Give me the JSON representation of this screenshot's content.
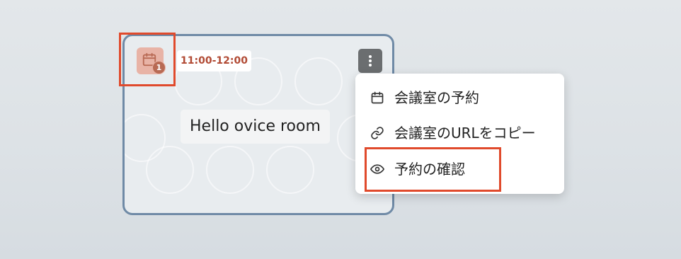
{
  "room": {
    "reservation_count": "1",
    "time_range": "11:00-12:00",
    "name": "Hello ovice room",
    "reservation_icon": "calendar-icon",
    "more_icon": "more-vertical-icon"
  },
  "menu": {
    "items": [
      {
        "label": "会議室の予約",
        "icon": "calendar-icon"
      },
      {
        "label": "会議室のURLをコピー",
        "icon": "link-icon"
      },
      {
        "label": "予約の確認",
        "icon": "eye-icon"
      }
    ]
  },
  "colors": {
    "card_border": "#6f8aa6",
    "time_text": "#b14a34",
    "highlight": "#e04a2c",
    "reservation_icon_bg": "#e8b3a6",
    "badge_bg": "#b86a54"
  }
}
